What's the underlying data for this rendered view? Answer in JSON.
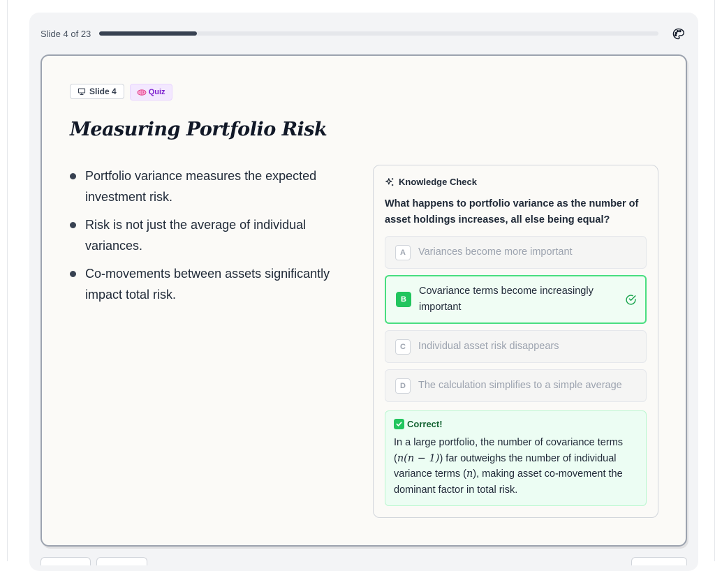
{
  "progress": {
    "label": "Slide 4 of 23",
    "fraction": 0.1739
  },
  "slide": {
    "badge_slide": "Slide 4",
    "badge_quiz": "Quiz",
    "title": "Measuring Portfolio Risk",
    "bullets": [
      "Portfolio variance measures the expected investment risk.",
      "Risk is not just the average of individual variances.",
      "Co-movements between assets significantly impact total risk."
    ]
  },
  "quiz": {
    "heading": "Knowledge Check",
    "question": "What happens to portfolio variance as the number of asset holdings increases, all else being equal?",
    "options": [
      {
        "letter": "A",
        "text": "Variances become more important",
        "state": "dimmed"
      },
      {
        "letter": "B",
        "text": "Covariance terms become increasingly important",
        "state": "correct"
      },
      {
        "letter": "C",
        "text": "Individual asset risk disappears",
        "state": "dimmed"
      },
      {
        "letter": "D",
        "text": "The calculation simplifies to a simple average",
        "state": "dimmed"
      }
    ],
    "feedback": {
      "heading": "Correct!",
      "text_1": "In a large portfolio, the number of covariance terms (",
      "math_1": "n(n − 1)",
      "text_2": ") far outweighs the number of individual variance terms (",
      "math_2": "n",
      "text_3": "), making asset co-movement the dominant factor in total risk."
    }
  },
  "colors": {
    "accent_correct": "#22c55e",
    "progress_fill": "#374151",
    "quiz_badge": "#7e22ce"
  },
  "icons": {
    "palette": "palette-icon",
    "slide_badge": "presentation-icon",
    "quiz_badge": "brain-icon",
    "knowledge_check": "sparkles-icon",
    "correct": "check-circle-icon",
    "feedback": "check-box-icon"
  }
}
